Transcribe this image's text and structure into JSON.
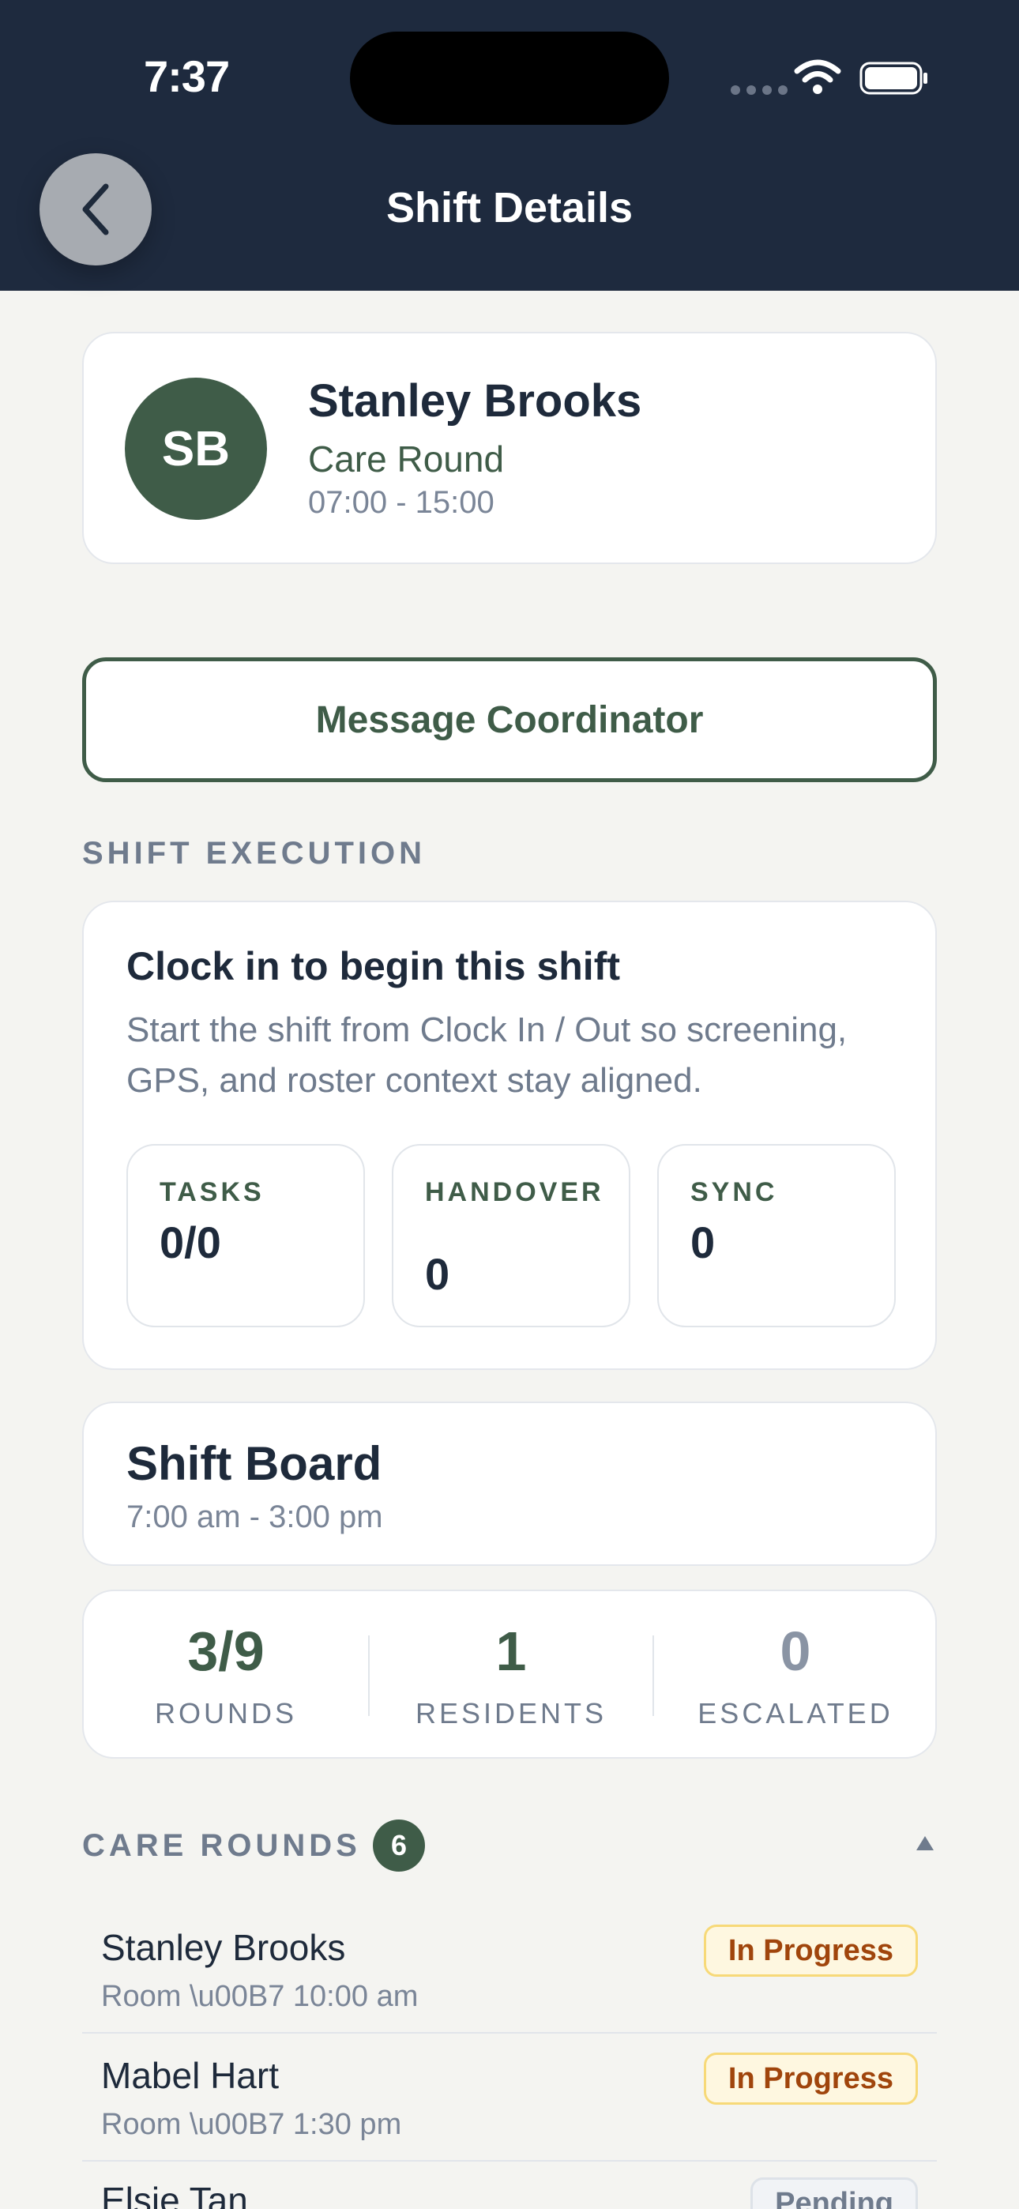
{
  "status_bar": {
    "time": "7:37"
  },
  "header": {
    "title": "Shift Details"
  },
  "profile": {
    "initials": "SB",
    "name": "Stanley Brooks",
    "role": "Care Round",
    "time": "07:00 - 15:00"
  },
  "actions": {
    "message_label": "Message Coordinator"
  },
  "execution": {
    "section_label": "SHIFT EXECUTION",
    "title": "Clock in to begin this shift",
    "description": "Start the shift from Clock In / Out so screening, GPS, and roster context stay aligned.",
    "stats": [
      {
        "label": "TASKS",
        "value": "0/0"
      },
      {
        "label": "HANDOVER",
        "value": "0"
      },
      {
        "label": "SYNC",
        "value": "0"
      }
    ]
  },
  "board": {
    "title": "Shift Board",
    "time": "7:00 am - 3:00 pm"
  },
  "metrics": [
    {
      "value": "3/9",
      "label": "ROUNDS",
      "color": "#3f5c48"
    },
    {
      "value": "1",
      "label": "RESIDENTS",
      "color": "#3f5c48"
    },
    {
      "value": "0",
      "label": "ESCALATED",
      "color": "#8a94a4"
    }
  ],
  "care_rounds": {
    "section_label": "CARE ROUNDS",
    "count": "6",
    "items": [
      {
        "name": "Stanley Brooks",
        "meta": "Room  \\u00B7 10:00 am",
        "status": "In Progress"
      },
      {
        "name": "Mabel Hart",
        "meta": "Room  \\u00B7 1:30 pm",
        "status": "In Progress"
      },
      {
        "name": "Elsie Tan",
        "meta": "",
        "status": "Pending"
      }
    ]
  },
  "colors": {
    "primary": "#3f5c48",
    "header_bg": "#1e2a3e",
    "page_bg": "#f4f4f1"
  }
}
